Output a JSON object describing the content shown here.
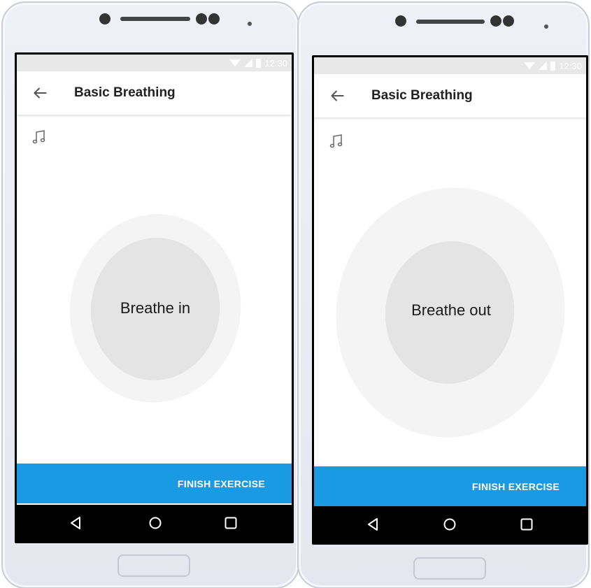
{
  "screens": [
    {
      "status": {
        "time": "12:30"
      },
      "appbar": {
        "title": "Basic Breathing",
        "back_icon": "arrow-back-icon"
      },
      "music_icon": "music-note-icon",
      "breath": {
        "instruction": "Breathe in"
      },
      "finish": {
        "label": "FINISH EXERCISE"
      }
    },
    {
      "status": {
        "time": "12:30"
      },
      "appbar": {
        "title": "Basic Breathing",
        "back_icon": "arrow-back-icon"
      },
      "music_icon": "music-note-icon",
      "breath": {
        "instruction": "Breathe out"
      },
      "finish": {
        "label": "FINISH EXERCISE"
      }
    }
  ],
  "nav": {
    "back_icon": "nav-back-icon",
    "home_icon": "nav-home-icon",
    "recents_icon": "nav-recents-icon"
  },
  "colors": {
    "accent": "#1a9ae2",
    "navbar": "#000000",
    "statusbar": "#e8e8e8",
    "blob_outer": "#f4f4f4",
    "blob_inner": "#e4e4e4"
  }
}
